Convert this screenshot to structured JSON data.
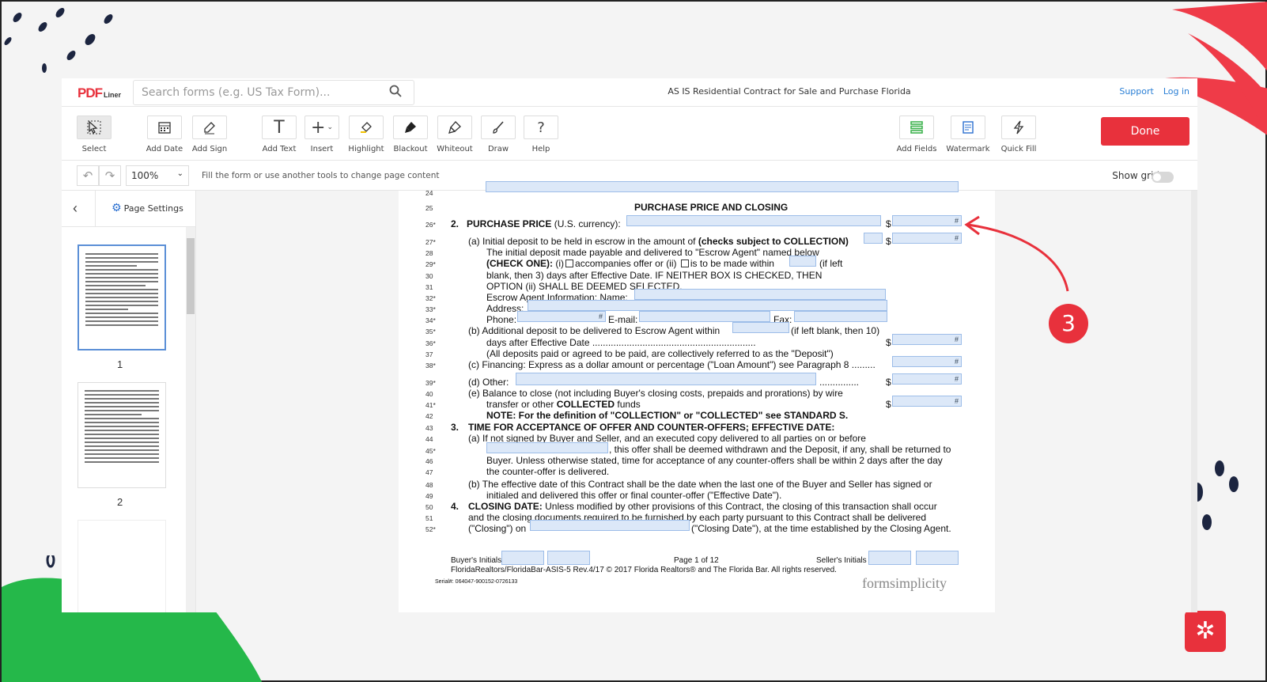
{
  "app": {
    "logo_main": "PDF",
    "logo_sub": "Liner",
    "doc_title": "AS IS Residential Contract for Sale and Purchase Florida",
    "support": "Support",
    "login": "Log in"
  },
  "search": {
    "placeholder": "Search forms (e.g. US Tax Form)..."
  },
  "toolbar": {
    "select": "Select",
    "add_date": "Add Date",
    "add_sign": "Add Sign",
    "add_text": "Add Text",
    "insert": "Insert",
    "highlight": "Highlight",
    "blackout": "Blackout",
    "whiteout": "Whiteout",
    "draw": "Draw",
    "help": "Help",
    "add_fields": "Add Fields",
    "watermark": "Watermark",
    "quick_fill": "Quick Fill",
    "done": "Done"
  },
  "options": {
    "zoom": "100%",
    "hint": "Fill the form or use another tools to change page content",
    "show_grid": "Show grid"
  },
  "sidebar": {
    "page_settings": "Page Settings",
    "pages": [
      "1",
      "2"
    ]
  },
  "step": "3",
  "form": {
    "n24": "24",
    "n25": "25",
    "n26": "26*",
    "n27": "27*",
    "n28": "28",
    "n29": "29*",
    "n30": "30",
    "n31": "31",
    "n32": "32*",
    "n33": "33*",
    "n34": "34*",
    "n35": "35*",
    "n36": "36*",
    "n37": "37",
    "n38": "38*",
    "n39": "39*",
    "n40": "40",
    "n41": "41*",
    "n42": "42",
    "n43": "43",
    "n44": "44",
    "n45": "45*",
    "n46": "46",
    "n47": "47",
    "n48": "48",
    "n49": "49",
    "n50": "50",
    "n51": "51",
    "n52": "52*",
    "heading": "PURCHASE PRICE AND CLOSING",
    "l26_num": "2.",
    "l26_a": "PURCHASE PRICE",
    "l26_b": "(U.S. currency):",
    "dollar": "$",
    "hash": "#",
    "l27_a": "(a)  Initial deposit to be held in escrow in the amount of",
    "l27_b": "(checks subject to COLLECTION)",
    "l28": "The initial deposit made payable and delivered to \"Escrow Agent\" named below",
    "l29_a": "(CHECK ONE):",
    "l29_b": "(i)",
    "l29_c": "accompanies offer or (ii)",
    "l29_d": "is to be made within",
    "l29_e": "(if left",
    "l30": "blank, then 3) days after Effective Date. IF NEITHER BOX IS CHECKED, THEN",
    "l31": "OPTION (ii) SHALL BE DEEMED SELECTED.",
    "l32": "Escrow Agent Information: Name:",
    "l33": "Address:",
    "l34_a": "Phone:",
    "l34_b": "E-mail:",
    "l34_c": "Fax:",
    "l35_a": "(b)  Additional deposit to be delivered to Escrow Agent within",
    "l35_b": "(if left blank, then 10)",
    "l36": "days after Effective Date ..............................................................",
    "l37": "(All deposits paid or agreed to be paid, are collectively referred to as the \"Deposit\")",
    "l38": "(c)  Financing: Express as a dollar amount or percentage (\"Loan Amount\") see Paragraph 8 .........",
    "l39": "(d)  Other:",
    "l39_dots": "...............",
    "l40": "(e)  Balance to close (not including Buyer's closing costs, prepaids and prorations) by wire",
    "l41_a": "transfer or other",
    "l41_b": "COLLECTED",
    "l41_c": "funds",
    "l42": "NOTE: For the definition of \"COLLECTION\" or \"COLLECTED\" see STANDARD S.",
    "l43_num": "3.",
    "l43": "TIME FOR ACCEPTANCE OF OFFER AND COUNTER-OFFERS; EFFECTIVE DATE:",
    "l44": "(a)  If  not  signed  by  Buyer  and  Seller,  and  an  executed  copy  delivered  to  all  parties  on  or  before",
    "l45": ", this offer shall be deemed withdrawn and the Deposit, if any, shall be returned to",
    "l46": "Buyer. Unless otherwise stated, time for acceptance of any counter-offers shall be within 2 days after the day",
    "l47": "the counter-offer is delivered.",
    "l48": "(b)  The effective date of this Contract shall be the date when the last one of the Buyer and Seller has signed or",
    "l49": "initialed and delivered this offer or final counter-offer (\"Effective Date\").",
    "l50_num": "4.",
    "l50_a": "CLOSING DATE:",
    "l50_b": "Unless modified by other provisions of this Contract, the closing of this transaction shall occur",
    "l51": "and the closing documents required to be furnished by each party pursuant to this Contract shall be delivered",
    "l52_a": "(\"Closing\") on",
    "l52_b": "(\"Closing Date\"), at the time established by the Closing Agent.",
    "buyer_initials": "Buyer's Initials",
    "page_of": "Page 1 of 12",
    "seller_initials": "Seller's Initials",
    "footer": "FloridaRealtors/FloridaBar-ASIS-5    Rev.4/17 © 2017 Florida Realtors® and The Florida Bar.  All rights reserved.",
    "serial": "Serial#: 064047-900152-0726133",
    "brand": "formsimplicity"
  }
}
